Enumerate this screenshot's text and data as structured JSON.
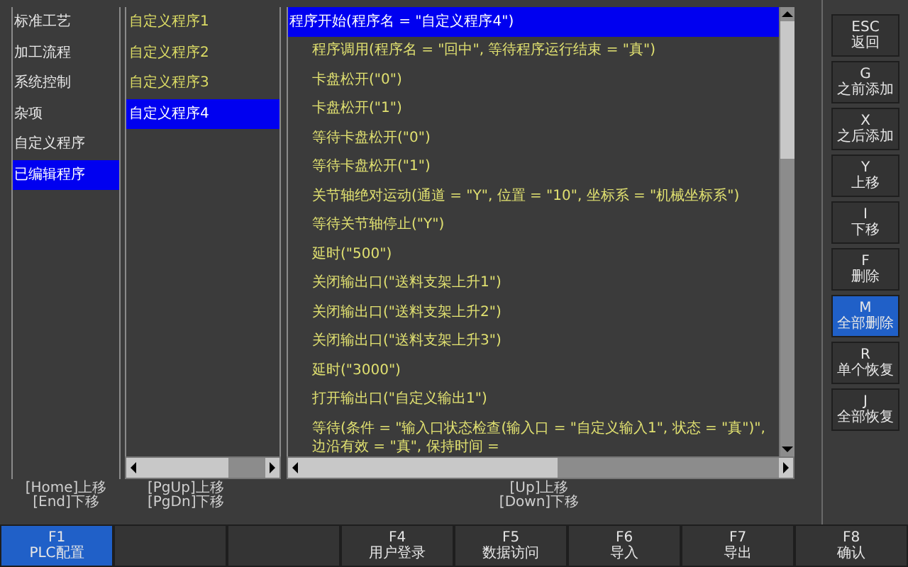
{
  "categories": [
    {
      "label": "标准工艺",
      "selected": false
    },
    {
      "label": "加工流程",
      "selected": false
    },
    {
      "label": "系统控制",
      "selected": false
    },
    {
      "label": "杂项",
      "selected": false
    },
    {
      "label": "自定义程序",
      "selected": false
    },
    {
      "label": "已编辑程序",
      "selected": true
    }
  ],
  "programs": [
    {
      "label": "自定义程序1",
      "selected": false
    },
    {
      "label": "自定义程序2",
      "selected": false
    },
    {
      "label": "自定义程序3",
      "selected": false
    },
    {
      "label": "自定义程序4",
      "selected": true
    }
  ],
  "code_lines": [
    {
      "text": "程序开始(程序名 = \"自定义程序4\")",
      "selected": true,
      "indented": false
    },
    {
      "text": "程序调用(程序名 = \"回中\", 等待程序运行结束 = \"真\")",
      "selected": false,
      "indented": true
    },
    {
      "text": "卡盘松开(\"0\")",
      "selected": false,
      "indented": true
    },
    {
      "text": "卡盘松开(\"1\")",
      "selected": false,
      "indented": true
    },
    {
      "text": "等待卡盘松开(\"0\")",
      "selected": false,
      "indented": true
    },
    {
      "text": "等待卡盘松开(\"1\")",
      "selected": false,
      "indented": true
    },
    {
      "text": "关节轴绝对运动(通道 = \"Y\", 位置 = \"10\", 坐标系 = \"机械坐标系\")",
      "selected": false,
      "indented": true
    },
    {
      "text": "等待关节轴停止(\"Y\")",
      "selected": false,
      "indented": true
    },
    {
      "text": "延时(\"500\")",
      "selected": false,
      "indented": true
    },
    {
      "text": "关闭输出口(\"送料支架上升1\")",
      "selected": false,
      "indented": true
    },
    {
      "text": "关闭输出口(\"送料支架上升2\")",
      "selected": false,
      "indented": true
    },
    {
      "text": "关闭输出口(\"送料支架上升3\")",
      "selected": false,
      "indented": true
    },
    {
      "text": "延时(\"3000\")",
      "selected": false,
      "indented": true
    },
    {
      "text": "打开输出口(\"自定义输出1\")",
      "selected": false,
      "indented": true
    },
    {
      "text": "等待(条件 = \"输入口状态检查(输入口 = \"自定义输入1\", 状态 = \"真\")\", 边沿有效 = \"真\", 保持时间 =",
      "selected": false,
      "indented": true
    }
  ],
  "hints": [
    [
      "[Home]上移",
      "[End]下移"
    ],
    [
      "[PgUp]上移",
      "[PgDn]下移"
    ],
    [
      "[Up]上移",
      "[Down]下移"
    ]
  ],
  "side_buttons": [
    {
      "key": "ESC",
      "label": "返回",
      "selected": false
    },
    {
      "key": "G",
      "label": "之前添加",
      "selected": false
    },
    {
      "key": "X",
      "label": "之后添加",
      "selected": false
    },
    {
      "key": "Y",
      "label": "上移",
      "selected": false
    },
    {
      "key": "I",
      "label": "下移",
      "selected": false
    },
    {
      "key": "F",
      "label": "删除",
      "selected": false
    },
    {
      "key": "M",
      "label": "全部删除",
      "selected": true
    },
    {
      "key": "R",
      "label": "单个恢复",
      "selected": false
    },
    {
      "key": "J",
      "label": "全部恢复",
      "selected": false
    }
  ],
  "function_keys": [
    {
      "key": "F1",
      "label": "PLC配置",
      "selected": true
    },
    {
      "selected": false
    },
    {
      "selected": false
    },
    {
      "key": "F4",
      "label": "用户登录",
      "selected": false
    },
    {
      "key": "F5",
      "label": "数据访问",
      "selected": false
    },
    {
      "key": "F6",
      "label": "导入",
      "selected": false
    },
    {
      "key": "F7",
      "label": "导出",
      "selected": false
    },
    {
      "key": "F8",
      "label": "确认",
      "selected": false
    }
  ]
}
